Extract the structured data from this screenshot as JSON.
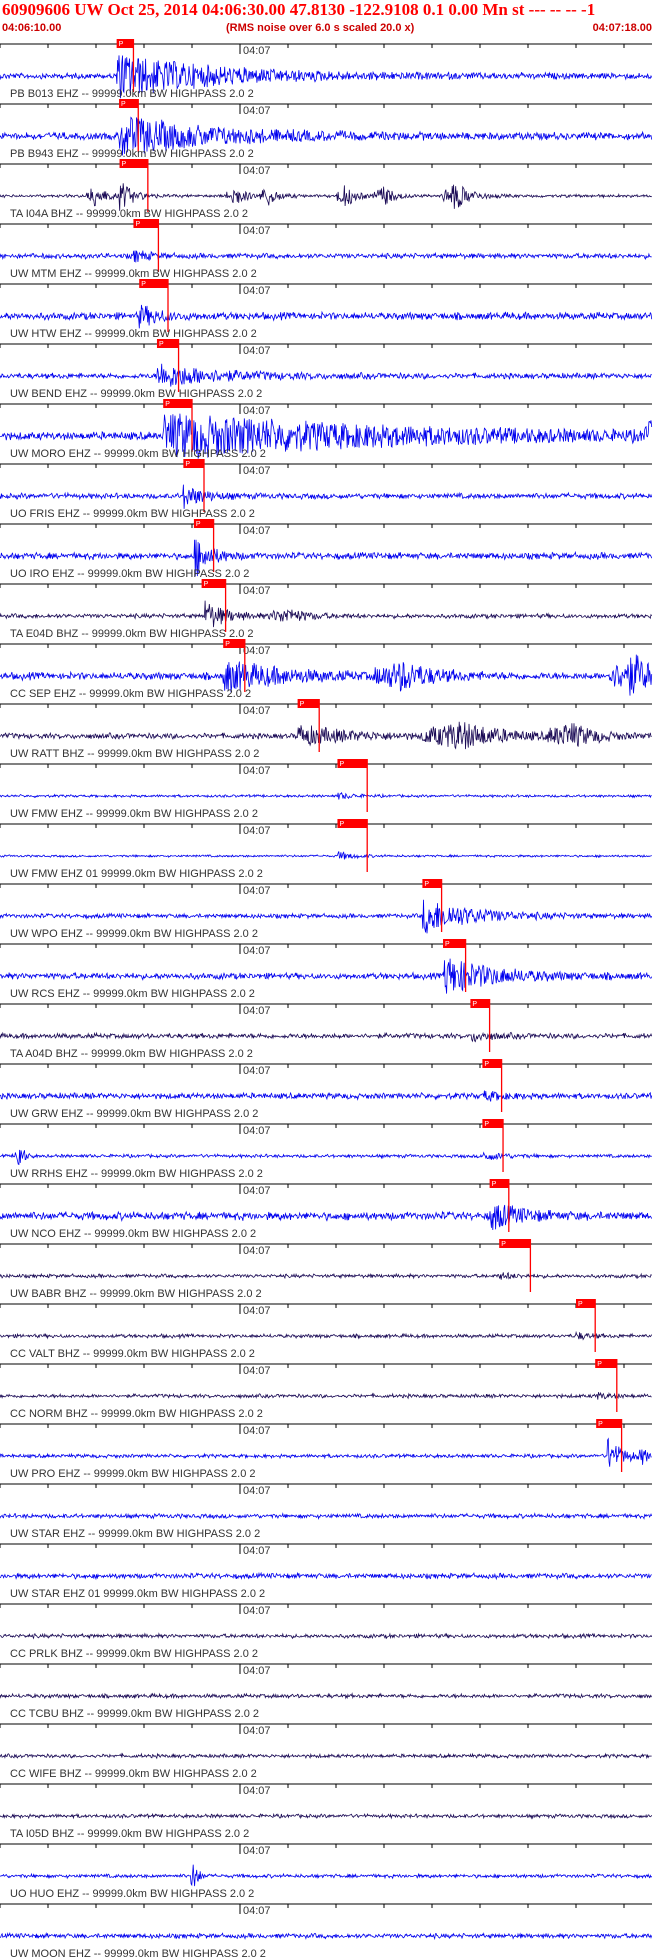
{
  "header": {
    "title": "60909606 UW Oct 25, 2014 04:06:30.00   47.8130 -122.9108  0.1 0.00 Mn st --- -- --  -1",
    "start_time": "04:06:10.00",
    "rms_note": "(RMS noise over 6.0 s scaled 20.0 x)",
    "end_time": "04:07:18.00"
  },
  "chart_data": {
    "type": "line",
    "title": "60909606 UW Oct 25, 2014 04:06:30.00   47.8130 -122.9108  0.1 0.00 Mn st --- -- --  -1",
    "xlabel": "",
    "ylabel": "",
    "xlim": [
      "04:06:10.00",
      "04:07:18.00"
    ],
    "major_tick_label": "04:07",
    "colors": {
      "trace_blue": "#0000ee",
      "trace_dark": "#1a0a55",
      "pick": "#ff0000",
      "axis": "#000000",
      "label": "#333333"
    },
    "pick_label": "P",
    "traces": [
      {
        "label": "PB B013 EHZ -- 99999.0km BW  HIGHPASS  2.0  2",
        "color": "blue",
        "pick_s": 24.3,
        "pick_end_s": 27.8,
        "onset_s": 24.0,
        "noise": 0.16,
        "peak": 1.0,
        "coda": 20,
        "extra": []
      },
      {
        "label": "PB B943 EHZ -- 99999.0km BW  HIGHPASS  2.0  2",
        "color": "blue",
        "pick_s": 24.8,
        "pick_end_s": 28.8,
        "onset_s": 24.8,
        "noise": 0.2,
        "peak": 0.9,
        "coda": 18,
        "extra": []
      },
      {
        "label": "TA I04A BHZ -- 99999.0km BW  HIGHPASS  2.0  2",
        "color": "dark",
        "pick_s": 24.9,
        "pick_end_s": 30.8,
        "onset_s": 24.9,
        "noise": 0.08,
        "peak": 0.7,
        "coda": 2.5,
        "extra": [
          [
            20,
            0.5,
            2
          ],
          [
            49,
            0.45,
            2
          ],
          [
            56,
            0.4,
            2
          ],
          [
            72,
            0.5,
            2
          ],
          [
            80,
            0.45,
            2
          ],
          [
            95,
            0.6,
            3
          ]
        ]
      },
      {
        "label": "UW MTM EHZ -- 99999.0km BW  HIGHPASS  2.0  2",
        "color": "blue",
        "pick_s": 27.8,
        "pick_end_s": 33.0,
        "onset_s": 27.8,
        "noise": 0.14,
        "peak": 0.25,
        "coda": 3,
        "extra": []
      },
      {
        "label": "UW HTW EHZ -- 99999.0km BW  HIGHPASS  2.0  2",
        "color": "blue",
        "pick_s": 29.0,
        "pick_end_s": 35.0,
        "onset_s": 29.0,
        "noise": 0.2,
        "peak": 0.45,
        "coda": 4,
        "extra": []
      },
      {
        "label": "UW BEND EHZ -- 99999.0km BW  HIGHPASS  2.0  2",
        "color": "blue",
        "pick_s": 32.7,
        "pick_end_s": 37.2,
        "onset_s": 32.7,
        "noise": 0.15,
        "peak": 0.55,
        "coda": 12,
        "extra": []
      },
      {
        "label": "UW MORO EHZ -- 99999.0km BW  HIGHPASS  2.0  2",
        "color": "blue",
        "pick_s": 34.0,
        "pick_end_s": 40.0,
        "onset_s": 34.0,
        "noise": 0.22,
        "peak": 1.0,
        "coda": 45,
        "extra": [
          [
            142,
            1.0,
            8
          ]
        ]
      },
      {
        "label": "UO FRIS EHZ -- 99999.0km BW  HIGHPASS  2.0  2",
        "color": "blue",
        "pick_s": 38.2,
        "pick_end_s": 42.5,
        "onset_s": 38.2,
        "noise": 0.15,
        "peak": 0.5,
        "coda": 4,
        "extra": []
      },
      {
        "label": "UO IRO EHZ -- 99999.0km BW  HIGHPASS  2.0  2",
        "color": "blue",
        "pick_s": 40.4,
        "pick_end_s": 44.5,
        "onset_s": 40.4,
        "noise": 0.18,
        "peak": 1.0,
        "coda": 3,
        "extra": []
      },
      {
        "label": "TA E04D BHZ -- 99999.0km BW  HIGHPASS  2.0  2",
        "color": "dark",
        "pick_s": 42.0,
        "pick_end_s": 47.0,
        "onset_s": 42.6,
        "noise": 0.12,
        "peak": 0.7,
        "coda": 4,
        "extra": [
          [
            60,
            0.3,
            4
          ]
        ]
      },
      {
        "label": "CC SEP EHZ -- 99999.0km BW  HIGHPASS  2.0  2",
        "color": "blue",
        "pick_s": 46.5,
        "pick_end_s": 51.0,
        "onset_s": 46.5,
        "noise": 0.2,
        "peak": 0.7,
        "coda": 12,
        "extra": [
          [
            84,
            0.6,
            6
          ],
          [
            132,
            0.9,
            5
          ]
        ]
      },
      {
        "label": "UW RATT BHZ -- 99999.0km BW  HIGHPASS  2.0  2",
        "color": "dark",
        "pick_s": 62.0,
        "pick_end_s": 66.5,
        "onset_s": 62.0,
        "noise": 0.15,
        "peak": 0.45,
        "coda": 10,
        "extra": [
          [
            96,
            0.6,
            8
          ],
          [
            119,
            0.5,
            5
          ]
        ]
      },
      {
        "label": "UW FMW EHZ -- 99999.0km BW  HIGHPASS  2.0  2",
        "color": "blue",
        "pick_s": 70.3,
        "pick_end_s": 76.5,
        "onset_s": 70.3,
        "noise": 0.07,
        "peak": 0.15,
        "coda": 3,
        "extra": []
      },
      {
        "label": "UW FMW EHZ 01 99999.0km BW  HIGHPASS  2.0  2",
        "color": "blue",
        "pick_s": 70.3,
        "pick_end_s": 76.5,
        "onset_s": 70.3,
        "noise": 0.06,
        "peak": 0.2,
        "coda": 3,
        "extra": []
      },
      {
        "label": "UW WPO EHZ -- 99999.0km BW  HIGHPASS  2.0  2",
        "color": "blue",
        "pick_s": 88.0,
        "pick_end_s": 92.0,
        "onset_s": 88.0,
        "noise": 0.12,
        "peak": 0.8,
        "coda": 10,
        "extra": []
      },
      {
        "label": "UW RCS EHZ -- 99999.0km BW  HIGHPASS  2.0  2",
        "color": "blue",
        "pick_s": 92.3,
        "pick_end_s": 97.0,
        "onset_s": 92.5,
        "noise": 0.17,
        "peak": 0.85,
        "coda": 10,
        "extra": []
      },
      {
        "label": "TA A04D BHZ -- 99999.0km BW  HIGHPASS  2.0  2",
        "color": "dark",
        "pick_s": 98.0,
        "pick_end_s": 102.0,
        "onset_s": 98.0,
        "noise": 0.14,
        "peak": 0.22,
        "coda": 4,
        "extra": []
      },
      {
        "label": "UW GRW EHZ -- 99999.0km BW  HIGHPASS  2.0  2",
        "color": "blue",
        "pick_s": 100.5,
        "pick_end_s": 104.5,
        "onset_s": 100.5,
        "noise": 0.16,
        "peak": 0.2,
        "coda": 4,
        "extra": []
      },
      {
        "label": "UW RRHS EHZ -- 99999.0km BW  HIGHPASS  2.0  2",
        "color": "blue",
        "pick_s": 100.5,
        "pick_end_s": 104.8,
        "onset_s": 100.5,
        "noise": 0.09,
        "peak": 0.2,
        "coda": 4,
        "extra": [
          [
            4.0,
            0.8,
            0.8
          ]
        ]
      },
      {
        "label": "UW NCO EHZ -- 99999.0km BW  HIGHPASS  2.0  2",
        "color": "blue",
        "pick_s": 102.0,
        "pick_end_s": 106.0,
        "onset_s": 102.0,
        "noise": 0.22,
        "peak": 0.6,
        "coda": 6,
        "extra": []
      },
      {
        "label": "UW BABR BHZ -- 99999.0km BW  HIGHPASS  2.0  2",
        "color": "dark",
        "pick_s": 104.0,
        "pick_end_s": 110.5,
        "onset_s": 104.0,
        "noise": 0.1,
        "peak": 0.15,
        "coda": 3,
        "extra": []
      },
      {
        "label": "CC VALT BHZ -- 99999.0km BW  HIGHPASS  2.0  2",
        "color": "dark",
        "pick_s": 120.0,
        "pick_end_s": 124.0,
        "onset_s": 120.0,
        "noise": 0.1,
        "peak": 0.15,
        "coda": 3,
        "extra": []
      },
      {
        "label": "CC NORM BHZ -- 99999.0km BW  HIGHPASS  2.0  2",
        "color": "dark",
        "pick_s": 124.0,
        "pick_end_s": 128.5,
        "onset_s": 124.0,
        "noise": 0.1,
        "peak": 0.15,
        "coda": 3,
        "extra": []
      },
      {
        "label": "UW PRO EHZ -- 99999.0km BW  HIGHPASS  2.0  2",
        "color": "blue",
        "pick_s": 124.2,
        "pick_end_s": 129.5,
        "onset_s": 126.5,
        "noise": 0.1,
        "peak": 0.8,
        "coda": 3,
        "extra": [
          [
            134,
            0.3,
            1
          ]
        ]
      },
      {
        "label": "UW STAR EHZ -- 99999.0km BW  HIGHPASS  2.0  2",
        "color": "blue",
        "pick_s": 140.0,
        "pick_end_s": 144.5,
        "onset_s": 142.0,
        "noise": 0.12,
        "peak": 0.6,
        "coda": 5,
        "extra": []
      },
      {
        "label": "UW STAR EHZ 01 99999.0km BW  HIGHPASS  2.0  2",
        "color": "blue",
        "pick_s": 140.0,
        "pick_end_s": 144.5,
        "onset_s": 142.0,
        "noise": 0.14,
        "peak": 0.8,
        "coda": 5,
        "extra": []
      },
      {
        "label": "CC PRLK BHZ -- 99999.0km BW  HIGHPASS  2.0  2",
        "color": "dark",
        "pick_s": null,
        "pick_end_s": null,
        "onset_s": null,
        "noise": 0.11,
        "peak": 0,
        "coda": 0,
        "extra": []
      },
      {
        "label": "CC TCBU BHZ -- 99999.0km BW  HIGHPASS  2.0  2",
        "color": "dark",
        "pick_s": null,
        "pick_end_s": null,
        "onset_s": null,
        "noise": 0.11,
        "peak": 0,
        "coda": 0,
        "extra": []
      },
      {
        "label": "CC WIFE BHZ -- 99999.0km BW  HIGHPASS  2.0  2",
        "color": "dark",
        "pick_s": null,
        "pick_end_s": null,
        "onset_s": null,
        "noise": 0.1,
        "peak": 0,
        "coda": 0,
        "extra": []
      },
      {
        "label": "TA I05D BHZ -- 99999.0km BW  HIGHPASS  2.0  2",
        "color": "dark",
        "pick_s": null,
        "pick_end_s": null,
        "onset_s": null,
        "noise": 0.1,
        "peak": 0,
        "coda": 0,
        "extra": []
      },
      {
        "label": "UO HUO EHZ -- 99999.0km BW  HIGHPASS  2.0  2",
        "color": "blue",
        "pick_s": null,
        "pick_end_s": null,
        "onset_s": null,
        "noise": 0.1,
        "peak": 0,
        "coda": 0,
        "extra": [
          [
            40.5,
            0.8,
            0.8
          ]
        ]
      },
      {
        "label": "UW MOON EHZ -- 99999.0km BW  HIGHPASS  2.0  2",
        "color": "blue",
        "pick_s": null,
        "pick_end_s": null,
        "onset_s": null,
        "noise": 0.13,
        "peak": 0,
        "coda": 0,
        "extra": []
      }
    ]
  }
}
